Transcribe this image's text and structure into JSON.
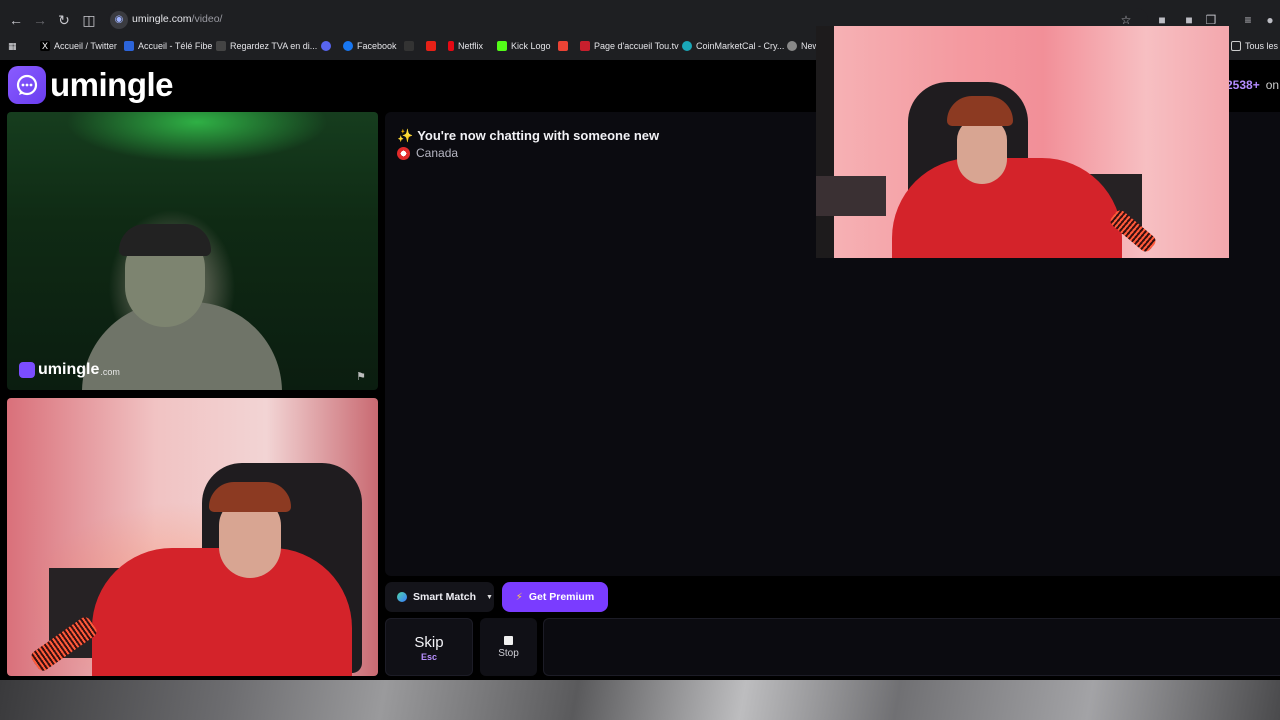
{
  "browser": {
    "url_host": "umingle.com",
    "url_path": "/video/",
    "bookmarks": [
      {
        "label": "Accueil / Twitter",
        "color": "#000000"
      },
      {
        "label": "Accueil - Télé Fibe",
        "color": "#2c64d9"
      },
      {
        "label": "Regardez TVA en di...",
        "color": "#444444"
      },
      {
        "label": "",
        "color": "#5865f2"
      },
      {
        "label": "Facebook",
        "color": "#1877f2"
      },
      {
        "label": "",
        "color": "#333333"
      },
      {
        "label": "",
        "color": "#e62117"
      },
      {
        "label": "Netflix",
        "color": "#e50914"
      },
      {
        "label": "Kick Logo",
        "color": "#53fc18"
      },
      {
        "label": "",
        "color": "#ea4335"
      },
      {
        "label": "Page d'accueil Tou.tv",
        "color": "#c71f2d"
      },
      {
        "label": "CoinMarketCal - Cry...",
        "color": "#1aa7b8"
      },
      {
        "label": "New",
        "color": "#888888"
      }
    ],
    "all_bookmarks_label": "Tous les"
  },
  "header": {
    "logo_text": "umingle",
    "online_count": "2538+",
    "online_suffix": "on"
  },
  "stranger": {
    "watermark_main": "umingle",
    "watermark_suffix": ".com"
  },
  "chat": {
    "status": "You're now chatting with someone new",
    "country": "Canada"
  },
  "controls": {
    "smart_match": "Smart Match",
    "premium": "Get Premium",
    "skip_label": "Skip",
    "skip_key": "Esc",
    "stop_label": "Stop"
  },
  "colors": {
    "accent": "#7a3cff",
    "panel": "#0b0b10"
  }
}
